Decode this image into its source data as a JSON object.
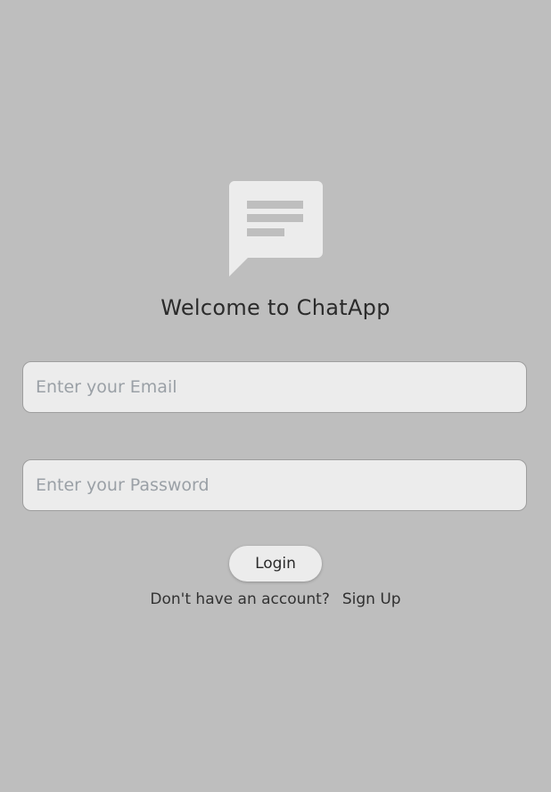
{
  "app": {
    "title": "Welcome to ChatApp",
    "logo_icon": "chat-message-icon",
    "background_color": "#bebebe"
  },
  "form": {
    "email_placeholder": "Enter your Email",
    "email_value": "",
    "password_placeholder": "Enter your Password",
    "password_value": "",
    "login_label": "Login"
  },
  "footer": {
    "prompt_text": "Don't have an account?",
    "signup_label": "Sign Up"
  }
}
